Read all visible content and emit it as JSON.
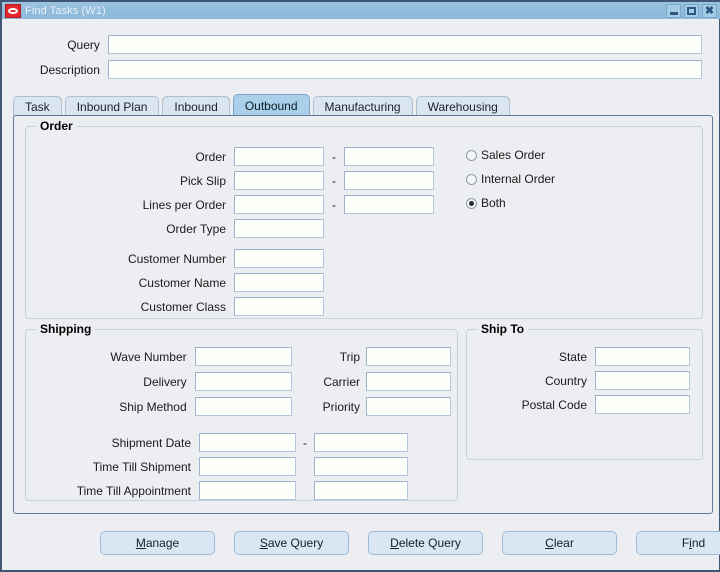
{
  "window": {
    "title": "Find Tasks (W1)",
    "logo_icon": "oracle-logo-icon",
    "minimize_label": "Minimize",
    "maximize_label": "Maximize",
    "close_label": "Close",
    "close_glyph": "✖"
  },
  "header": {
    "query_label": "Query",
    "query_value": "",
    "description_label": "Description",
    "description_value": ""
  },
  "tabs": [
    {
      "label": "Task",
      "active": false
    },
    {
      "label": "Inbound Plan",
      "active": false
    },
    {
      "label": "Inbound",
      "active": false
    },
    {
      "label": "Outbound",
      "active": true
    },
    {
      "label": "Manufacturing",
      "active": false
    },
    {
      "label": "Warehousing",
      "active": false
    }
  ],
  "order_group": {
    "title": "Order",
    "fields": [
      {
        "label": "Order",
        "value": "",
        "value_to": "",
        "has_range": true
      },
      {
        "label": "Pick Slip",
        "value": "",
        "value_to": "",
        "has_range": true
      },
      {
        "label": "Lines per Order",
        "value": "",
        "value_to": "",
        "has_range": true
      },
      {
        "label": "Order Type",
        "value": "",
        "has_range": false
      },
      {
        "label": "Customer Number",
        "value": "",
        "has_range": false
      },
      {
        "label": "Customer Name",
        "value": "",
        "has_range": false
      },
      {
        "label": "Customer Class",
        "value": "",
        "has_range": false
      }
    ],
    "range_separator": "-",
    "order_source": {
      "options": [
        {
          "label": "Sales Order",
          "selected": false
        },
        {
          "label": "Internal Order",
          "selected": false
        },
        {
          "label": "Both",
          "selected": true
        }
      ]
    }
  },
  "shipping_group": {
    "title": "Shipping",
    "left_fields": [
      {
        "label": "Wave Number",
        "value": ""
      },
      {
        "label": "Delivery",
        "value": ""
      },
      {
        "label": "Ship Method",
        "value": ""
      }
    ],
    "right_fields": [
      {
        "label": "Trip",
        "value": ""
      },
      {
        "label": "Carrier",
        "value": ""
      },
      {
        "label": "Priority",
        "value": ""
      }
    ],
    "date_fields": [
      {
        "label": "Shipment Date",
        "value": "",
        "value_to": "",
        "separator": "-"
      },
      {
        "label": "Time Till Shipment",
        "value": "",
        "value_to": "",
        "separator": ""
      },
      {
        "label": "Time Till Appointment",
        "value": "",
        "value_to": "",
        "separator": ""
      }
    ]
  },
  "shipto_group": {
    "title": "Ship To",
    "fields": [
      {
        "label": "State",
        "value": ""
      },
      {
        "label": "Country",
        "value": ""
      },
      {
        "label": "Postal Code",
        "value": ""
      }
    ]
  },
  "buttons": [
    {
      "label": "Manage",
      "accel_index": 0
    },
    {
      "label": "Save Query",
      "accel_index": 0
    },
    {
      "label": "Delete Query",
      "accel_index": 0
    },
    {
      "label": "Clear",
      "accel_index": 0
    },
    {
      "label": "Find",
      "accel_index": 1
    }
  ],
  "colors": {
    "window_frame": "#3f5675",
    "titlebar": "#92bcdc",
    "app_background": "#eceef2",
    "field_background": "#fdfffa",
    "field_border": "#b3c6db",
    "tab_active": "#a9cfeb",
    "tab_inactive": "#dbe5f0",
    "button_face": "#d9e6f3",
    "oracle_red": "#e4262c"
  }
}
